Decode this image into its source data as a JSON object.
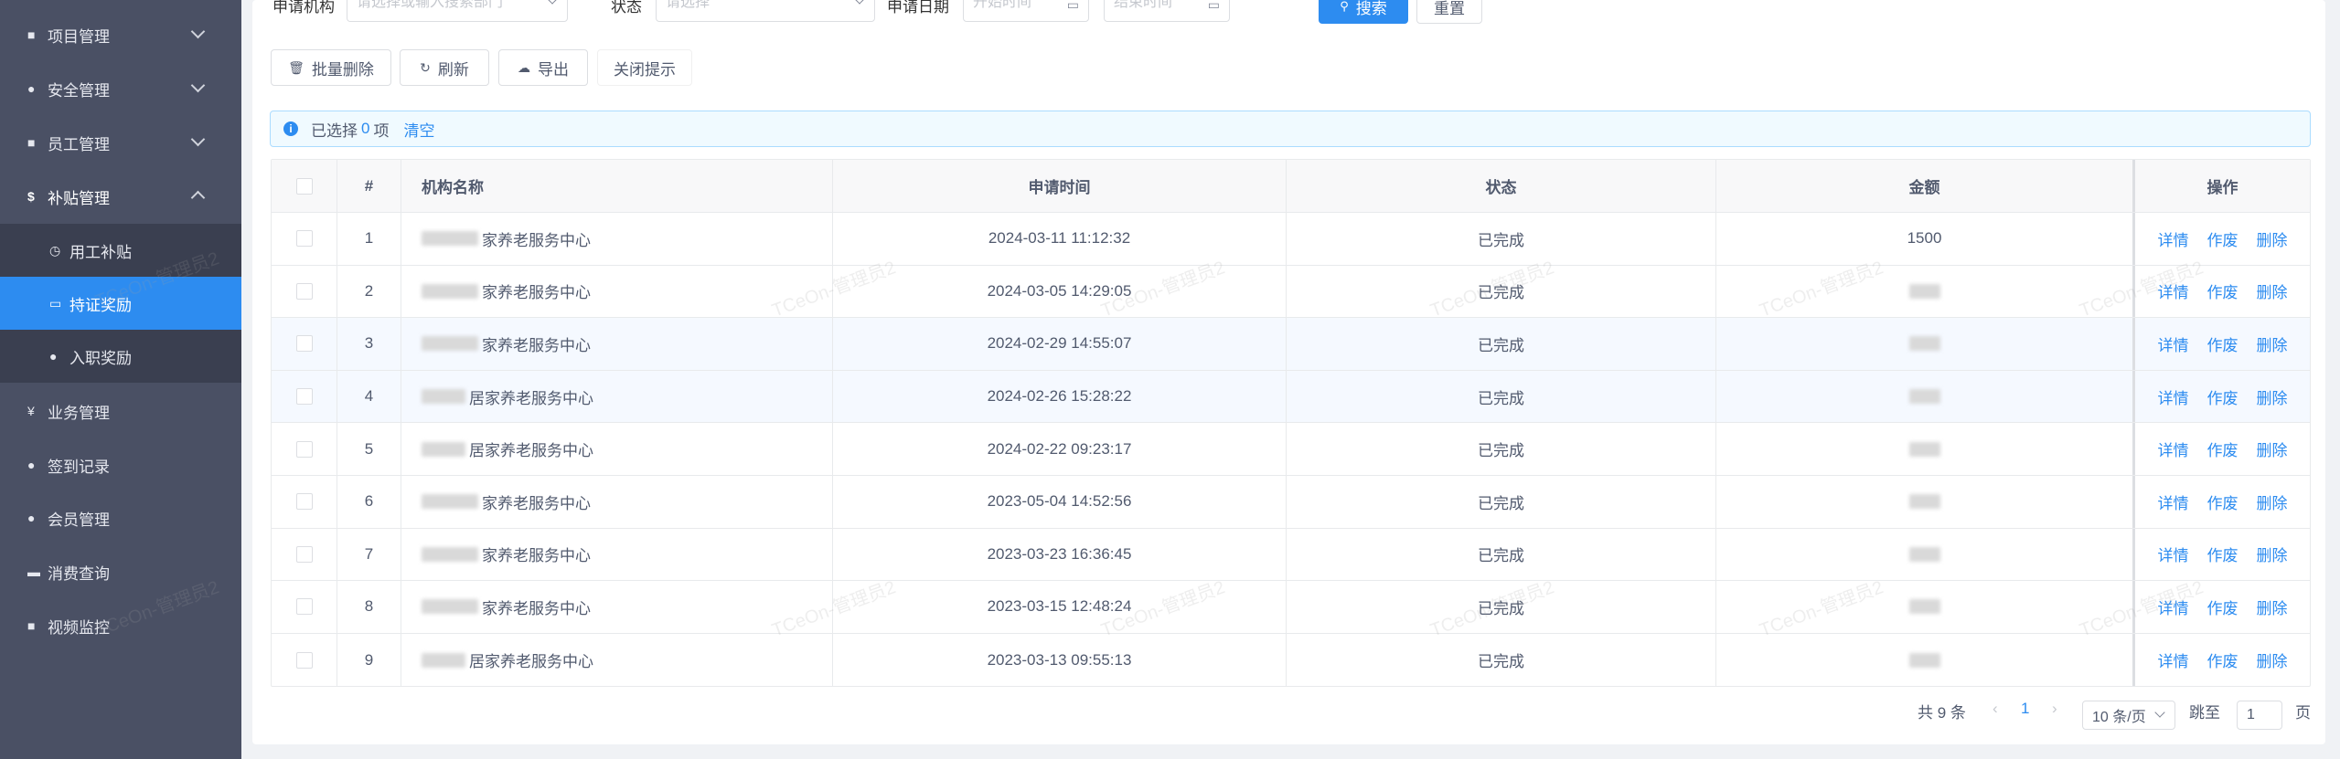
{
  "sidebar": {
    "items": [
      {
        "icon": "■",
        "label": "项目管理",
        "chevron": "down"
      },
      {
        "icon": "●",
        "label": "安全管理",
        "chevron": "down"
      },
      {
        "icon": "■",
        "label": "员工管理",
        "chevron": "down"
      },
      {
        "icon": "$",
        "label": "补贴管理",
        "chevron": "up"
      },
      {
        "icon": "◷",
        "label": "用工补贴"
      },
      {
        "icon": "▭",
        "label": "持证奖励"
      },
      {
        "icon": "●",
        "label": "入职奖励"
      },
      {
        "icon": "¥",
        "label": "业务管理"
      },
      {
        "icon": "●",
        "label": "签到记录"
      },
      {
        "icon": "●",
        "label": "会员管理"
      },
      {
        "icon": "▬",
        "label": "消费查询"
      },
      {
        "icon": "■",
        "label": "视频监控"
      }
    ]
  },
  "filters": {
    "org_label": "申请机构",
    "org_placeholder": "请选择或输入搜索部门",
    "status_label": "状态",
    "status_placeholder": "请选择",
    "date_label": "申请日期",
    "start_placeholder": "开始时间",
    "end_placeholder": "结束时间",
    "search_label": "搜索",
    "reset_label": "重置"
  },
  "toolbar": {
    "batch_delete": "批量删除",
    "refresh": "刷新",
    "export": "导出",
    "close_tip": "关闭提示"
  },
  "alert": {
    "prefix": "已选择",
    "count": "0",
    "suffix": "项",
    "clear": "清空"
  },
  "table": {
    "headers": {
      "index": "#",
      "org": "机构名称",
      "time": "申请时间",
      "status": "状态",
      "amount": "金额",
      "ops": "操作"
    },
    "ops": {
      "detail": "详情",
      "void": "作废",
      "delete": "删除"
    },
    "rows": [
      {
        "index": "1",
        "org": "家养老服务中心",
        "time": "2024-03-11 11:12:32",
        "status": "已完成",
        "amount": "1500"
      },
      {
        "index": "2",
        "org": "家养老服务中心",
        "time": "2024-03-05 14:29:05",
        "status": "已完成",
        "amount": ""
      },
      {
        "index": "3",
        "org": "家养老服务中心",
        "time": "2024-02-29 14:55:07",
        "status": "已完成",
        "amount": ""
      },
      {
        "index": "4",
        "org": "居家养老服务中心",
        "time": "2024-02-26 15:28:22",
        "status": "已完成",
        "amount": ""
      },
      {
        "index": "5",
        "org": "居家养老服务中心",
        "time": "2024-02-22 09:23:17",
        "status": "已完成",
        "amount": ""
      },
      {
        "index": "6",
        "org": "家养老服务中心",
        "time": "2023-05-04 14:52:56",
        "status": "已完成",
        "amount": ""
      },
      {
        "index": "7",
        "org": "家养老服务中心",
        "time": "2023-03-23 16:36:45",
        "status": "已完成",
        "amount": ""
      },
      {
        "index": "8",
        "org": "家养老服务中心",
        "time": "2023-03-15 12:48:24",
        "status": "已完成",
        "amount": ""
      },
      {
        "index": "9",
        "org": "居家养老服务中心",
        "time": "2023-03-13 09:55:13",
        "status": "已完成",
        "amount": ""
      }
    ]
  },
  "pagination": {
    "total": "共 9 条",
    "current": "1",
    "page_size": "10 条/页",
    "jump_label": "跳至",
    "jump_value": "1",
    "page_suffix": "页"
  },
  "watermark": "TCeOn-管理员2",
  "colors": {
    "primary": "#2d8cf0",
    "sidebar": "#4a5064",
    "sidebar_sub": "#3a3f50"
  }
}
